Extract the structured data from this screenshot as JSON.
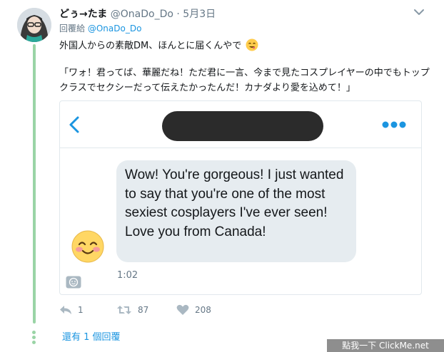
{
  "tweet": {
    "display_name": "どぅ→たま",
    "handle": "@OnaDo_Do",
    "separator": "·",
    "date": "5月3日",
    "reply_prefix": "回覆給",
    "reply_handle": "@OnaDo_Do",
    "text_line1": "外国人からの素敵DM、ほんとに届くんやで",
    "text_quote": "「ワォ！君ってば、華麗だね！ただ君に一言、今まで見たコスプレイヤーの中でもトップクラスでセクシーだって伝えたかったんだ！カナダより愛を込めて！」"
  },
  "dm_card": {
    "message": "Wow! You're gorgeous! I just wanted to say that you're one of the most sexiest cosplayers I've ever seen! Love you from Canada!",
    "time": "1:02"
  },
  "actions": {
    "reply_count": "1",
    "retweet_count": "87",
    "like_count": "208"
  },
  "thread": {
    "more_replies": "還有 1 個回覆"
  },
  "watermark": "點我一下 ClickMe.net",
  "icons": {
    "caret": "chevron-down-icon",
    "back": "chevron-left-icon",
    "more": "more-dots-icon",
    "reply": "reply-icon",
    "retweet": "retweet-icon",
    "like": "heart-icon",
    "emoji": "smiling-face-icon",
    "sticker": "smiley-button-icon"
  },
  "colors": {
    "link_blue": "#1b95e0",
    "thread_green": "#9ad4a6",
    "secondary_text": "#657786",
    "bubble_gray": "#e6ecf0",
    "redaction": "#2b2b2b"
  }
}
